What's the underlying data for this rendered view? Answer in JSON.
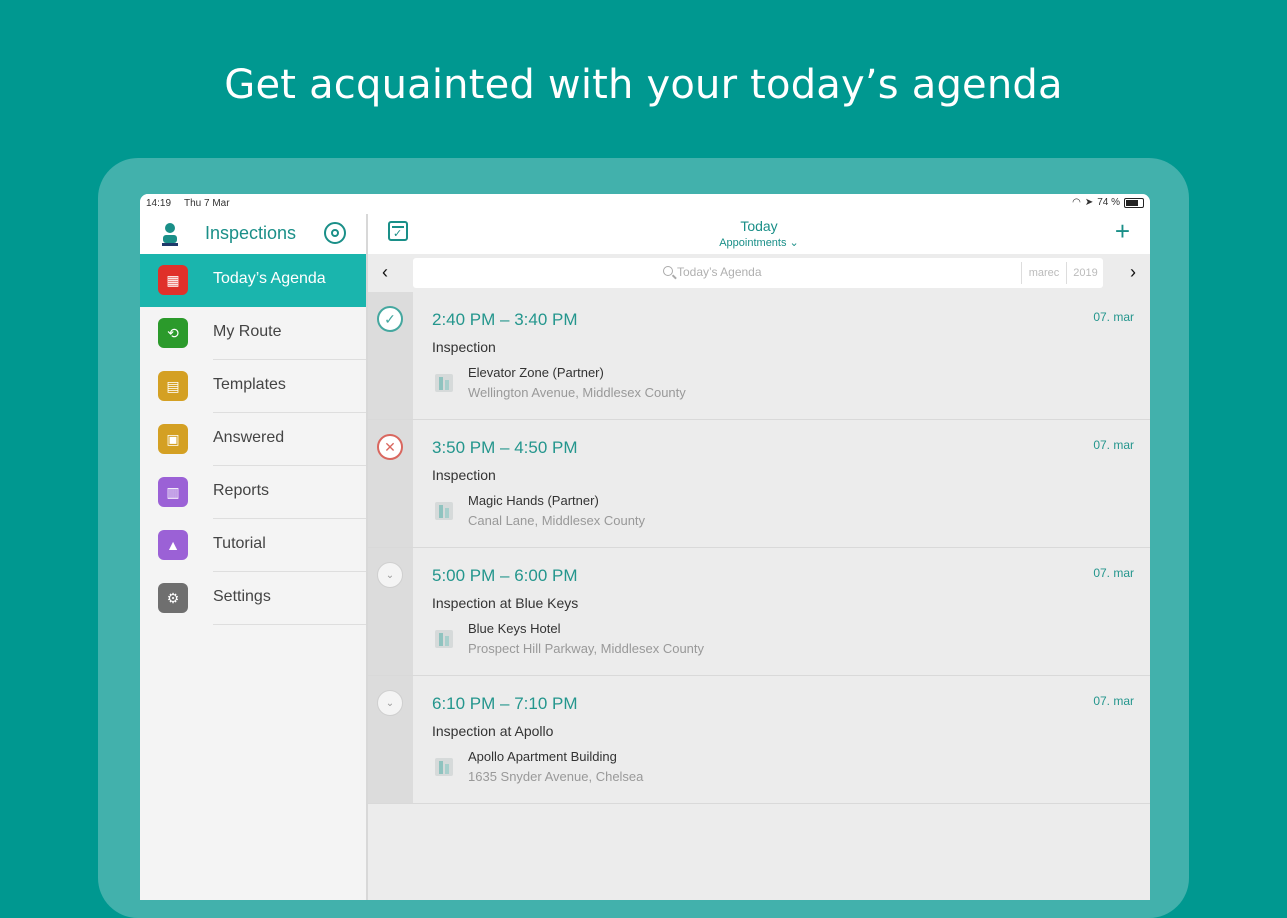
{
  "headline": "Get acquainted with your today’s agenda",
  "colors": {
    "background": "#009890",
    "accent": "#1a8f88",
    "active_nav": "#1ab5ad",
    "status_done": "#45a79f",
    "status_cancel": "#d9675f"
  },
  "status_bar": {
    "time": "14:19",
    "date": "Thu 7 Mar",
    "battery": "74 %"
  },
  "sidebar": {
    "title": "Inspections",
    "items": [
      {
        "label": "Today’s Agenda",
        "icon": "calendar-icon",
        "color": "#e0302a",
        "active": true
      },
      {
        "label": "My Route",
        "icon": "route-icon",
        "color": "#2b9a2b",
        "active": false
      },
      {
        "label": "Templates",
        "icon": "templates-icon",
        "color": "#d4a023",
        "active": false
      },
      {
        "label": "Answered",
        "icon": "answered-icon",
        "color": "#d4a023",
        "active": false
      },
      {
        "label": "Reports",
        "icon": "reports-icon",
        "color": "#9b61d6",
        "active": false
      },
      {
        "label": "Tutorial",
        "icon": "tutorial-icon",
        "color": "#9b61d6",
        "active": false
      },
      {
        "label": "Settings",
        "icon": "gear-icon",
        "color": "#6f6f6f",
        "active": false
      }
    ]
  },
  "topbar": {
    "title": "Today",
    "subtitle": "Appointments ⌄"
  },
  "search": {
    "placeholder": "Today’s Agenda",
    "month": "marec",
    "year": "2019"
  },
  "appointments": [
    {
      "time": "2:40 PM – 3:40 PM",
      "date": "07. mar",
      "type": "Inspection",
      "location": "Elevator Zone (Partner)",
      "address": "Wellington Avenue, Middlesex County",
      "status": "done",
      "status_icon": "check-icon"
    },
    {
      "time": "3:50 PM – 4:50 PM",
      "date": "07. mar",
      "type": "Inspection",
      "location": "Magic Hands (Partner)",
      "address": "Canal Lane, Middlesex County",
      "status": "cancelled",
      "status_icon": "cross-icon"
    },
    {
      "time": "5:00 PM – 6:00 PM",
      "date": "07. mar",
      "type": "Inspection at Blue Keys",
      "location": "Blue Keys Hotel",
      "address": "Prospect Hill Parkway, Middlesex County",
      "status": "pending",
      "status_icon": "chevron-down-icon"
    },
    {
      "time": "6:10 PM – 7:10 PM",
      "date": "07. mar",
      "type": "Inspection at Apollo",
      "location": "Apollo Apartment Building",
      "address": "1635 Snyder Avenue, Chelsea",
      "status": "pending",
      "status_icon": "chevron-down-icon"
    }
  ]
}
